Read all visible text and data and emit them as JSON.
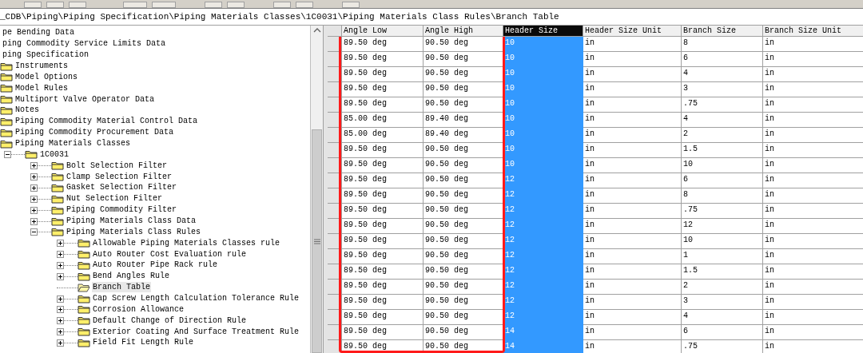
{
  "path_bar": {
    "text": "_CDB\\Piping\\Piping Specification\\Piping Materials Classes\\1C0031\\Piping Materials Class Rules\\Branch Table"
  },
  "tree": {
    "items": [
      {
        "label": "pe Bending Data",
        "kind": "text",
        "selected": false
      },
      {
        "label": "ping Commodity Service Limits Data",
        "kind": "text",
        "selected": false
      },
      {
        "label": "ping Specification",
        "kind": "text",
        "selected": false
      },
      {
        "label": "Instruments",
        "kind": "folder",
        "selected": false
      },
      {
        "label": "Model Options",
        "kind": "folder",
        "selected": false
      },
      {
        "label": "Model Rules",
        "kind": "folder",
        "selected": false
      },
      {
        "label": "Multiport Valve Operator Data",
        "kind": "folder",
        "selected": false
      },
      {
        "label": "Notes",
        "kind": "folder",
        "selected": false
      },
      {
        "label": "Piping Commodity Material Control Data",
        "kind": "folder",
        "selected": false
      },
      {
        "label": "Piping Commodity Procurement Data",
        "kind": "folder",
        "selected": false
      },
      {
        "label": "Piping Materials Classes",
        "kind": "folder",
        "selected": false,
        "children": [
          {
            "label": "1C0031",
            "kind": "folder",
            "selected": false,
            "expanded": true,
            "children": [
              {
                "label": "Bolt Selection Filter",
                "kind": "folder",
                "selected": false,
                "expanded": false
              },
              {
                "label": "Clamp Selection Filter",
                "kind": "folder",
                "selected": false,
                "expanded": false
              },
              {
                "label": "Gasket Selection Filter",
                "kind": "folder",
                "selected": false,
                "expanded": false
              },
              {
                "label": "Nut Selection Filter",
                "kind": "folder",
                "selected": false,
                "expanded": false
              },
              {
                "label": "Piping Commodity Filter",
                "kind": "folder",
                "selected": false,
                "expanded": false
              },
              {
                "label": "Piping Materials Class Data",
                "kind": "folder",
                "selected": false,
                "expanded": false
              },
              {
                "label": "Piping Materials Class Rules",
                "kind": "folder",
                "selected": false,
                "expanded": true,
                "children": [
                  {
                    "label": "Allowable Piping Materials Classes rule",
                    "kind": "folder",
                    "selected": false,
                    "expanded": false
                  },
                  {
                    "label": "Auto Router Cost Evaluation rule",
                    "kind": "folder",
                    "selected": false,
                    "expanded": false
                  },
                  {
                    "label": "Auto Router Pipe Rack rule",
                    "kind": "folder",
                    "selected": false,
                    "expanded": false
                  },
                  {
                    "label": "Bend Angles Rule",
                    "kind": "folder",
                    "selected": false,
                    "expanded": false
                  },
                  {
                    "label": "Branch Table",
                    "kind": "open-folder",
                    "selected": true
                  },
                  {
                    "label": "Cap Screw Length Calculation Tolerance Rule",
                    "kind": "folder",
                    "selected": false,
                    "expanded": false
                  },
                  {
                    "label": "Corrosion Allowance",
                    "kind": "folder",
                    "selected": false,
                    "expanded": false
                  },
                  {
                    "label": "Default Change of Direction Rule",
                    "kind": "folder",
                    "selected": false,
                    "expanded": false
                  },
                  {
                    "label": "Exterior Coating And Surface Treatment Rule",
                    "kind": "folder",
                    "selected": false,
                    "expanded": false
                  },
                  {
                    "label": "Field Fit Length Rule",
                    "kind": "folder",
                    "selected": false,
                    "expanded": false
                  }
                ]
              }
            ]
          }
        ]
      }
    ]
  },
  "table": {
    "columns": [
      {
        "label": "Angle Low",
        "selected": false,
        "highlighted": true
      },
      {
        "label": "Angle High",
        "selected": false,
        "highlighted": true
      },
      {
        "label": "Header Size",
        "selected": true,
        "highlighted": false
      },
      {
        "label": "Header Size Unit",
        "selected": false,
        "highlighted": false
      },
      {
        "label": "Branch Size",
        "selected": false,
        "highlighted": false
      },
      {
        "label": "Branch Size Unit",
        "selected": false,
        "highlighted": false
      }
    ],
    "rows": [
      [
        "89.50 deg",
        "90.50 deg",
        "10",
        "in",
        "8",
        "in"
      ],
      [
        "89.50 deg",
        "90.50 deg",
        "10",
        "in",
        "6",
        "in"
      ],
      [
        "89.50 deg",
        "90.50 deg",
        "10",
        "in",
        "4",
        "in"
      ],
      [
        "89.50 deg",
        "90.50 deg",
        "10",
        "in",
        "3",
        "in"
      ],
      [
        "89.50 deg",
        "90.50 deg",
        "10",
        "in",
        ".75",
        "in"
      ],
      [
        "85.00 deg",
        "89.40 deg",
        "10",
        "in",
        "4",
        "in"
      ],
      [
        "85.00 deg",
        "89.40 deg",
        "10",
        "in",
        "2",
        "in"
      ],
      [
        "89.50 deg",
        "90.50 deg",
        "10",
        "in",
        "1.5",
        "in"
      ],
      [
        "89.50 deg",
        "90.50 deg",
        "10",
        "in",
        "10",
        "in"
      ],
      [
        "89.50 deg",
        "90.50 deg",
        "12",
        "in",
        "6",
        "in"
      ],
      [
        "89.50 deg",
        "90.50 deg",
        "12",
        "in",
        "8",
        "in"
      ],
      [
        "89.50 deg",
        "90.50 deg",
        "12",
        "in",
        ".75",
        "in"
      ],
      [
        "89.50 deg",
        "90.50 deg",
        "12",
        "in",
        "12",
        "in"
      ],
      [
        "89.50 deg",
        "90.50 deg",
        "12",
        "in",
        "10",
        "in"
      ],
      [
        "89.50 deg",
        "90.50 deg",
        "12",
        "in",
        "1",
        "in"
      ],
      [
        "89.50 deg",
        "90.50 deg",
        "12",
        "in",
        "1.5",
        "in"
      ],
      [
        "89.50 deg",
        "90.50 deg",
        "12",
        "in",
        "2",
        "in"
      ],
      [
        "89.50 deg",
        "90.50 deg",
        "12",
        "in",
        "3",
        "in"
      ],
      [
        "89.50 deg",
        "90.50 deg",
        "12",
        "in",
        "4",
        "in"
      ],
      [
        "89.50 deg",
        "90.50 deg",
        "14",
        "in",
        "6",
        "in"
      ],
      [
        "89.50 deg",
        "90.50 deg",
        "14",
        "in",
        ".75",
        "in"
      ]
    ]
  }
}
